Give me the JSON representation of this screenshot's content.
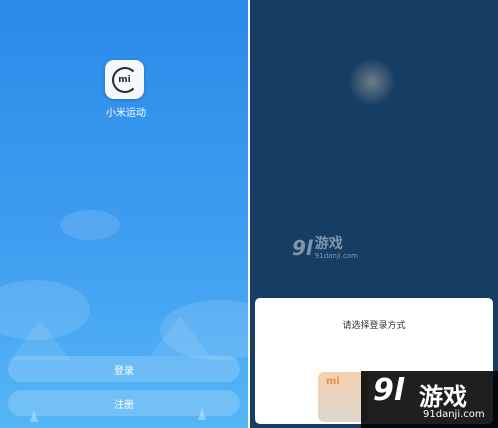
{
  "left_screen": {
    "app_name": "小米运动",
    "app_icon_text": "mi",
    "login_label": "登录",
    "register_label": "注册",
    "background_color": "#3f9df0"
  },
  "right_screen": {
    "sheet_title": "请选择登录方式",
    "option_icon_text": "mi",
    "background_color": "#163d63",
    "watermark_small": {
      "text": "游戏",
      "url": "91danji.com"
    }
  },
  "watermark": {
    "logo": "9l",
    "text": "游戏",
    "url": "91danji.com"
  }
}
